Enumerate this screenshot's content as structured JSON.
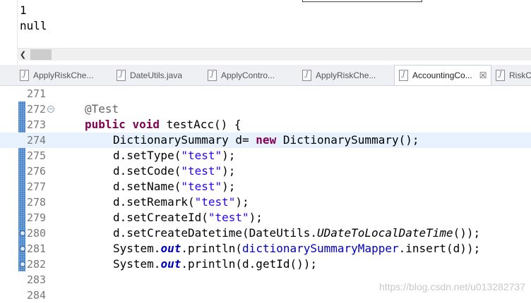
{
  "console": {
    "lines": [
      "1",
      "null"
    ]
  },
  "tabs": [
    {
      "label": "ApplyRiskChe...",
      "active": false
    },
    {
      "label": "DateUtils.java",
      "active": false
    },
    {
      "label": "ApplyContro...",
      "active": false
    },
    {
      "label": "ApplyRiskChe...",
      "active": false
    },
    {
      "label": "AccountingCo...",
      "active": true,
      "close": "☒"
    },
    {
      "label": "RiskCo",
      "active": false
    }
  ],
  "editor": {
    "current_line": 274,
    "lines": [
      {
        "number": "271",
        "tokens": []
      },
      {
        "number": "272",
        "tokens": [
          {
            "t": "@Test",
            "c": "ann"
          }
        ]
      },
      {
        "number": "273",
        "tokens": [
          {
            "t": "public",
            "c": "kw"
          },
          {
            "t": " "
          },
          {
            "t": "void",
            "c": "kw"
          },
          {
            "t": " testAcc() {"
          }
        ]
      },
      {
        "number": "274",
        "tokens": [
          {
            "t": "DictionarySummary d= "
          },
          {
            "t": "new",
            "c": "kw"
          },
          {
            "t": " DictionarySummary();"
          }
        ]
      },
      {
        "number": "275",
        "tokens": [
          {
            "t": "d.setType("
          },
          {
            "t": "\"test\"",
            "c": "str"
          },
          {
            "t": ");"
          }
        ]
      },
      {
        "number": "276",
        "tokens": [
          {
            "t": "d.setCode("
          },
          {
            "t": "\"test\"",
            "c": "str"
          },
          {
            "t": ");"
          }
        ]
      },
      {
        "number": "277",
        "tokens": [
          {
            "t": "d.setName("
          },
          {
            "t": "\"test\"",
            "c": "str"
          },
          {
            "t": ");"
          }
        ]
      },
      {
        "number": "278",
        "tokens": [
          {
            "t": "d.setRemark("
          },
          {
            "t": "\"test\"",
            "c": "str"
          },
          {
            "t": ");"
          }
        ]
      },
      {
        "number": "279",
        "tokens": [
          {
            "t": "d.setCreateId("
          },
          {
            "t": "\"test\"",
            "c": "str"
          },
          {
            "t": ");"
          }
        ]
      },
      {
        "number": "280",
        "tokens": [
          {
            "t": "d.setCreateDatetime(DateUtils."
          },
          {
            "t": "UDateToLocalDateTime",
            "c": "smethod"
          },
          {
            "t": "());"
          }
        ]
      },
      {
        "number": "281",
        "tokens": [
          {
            "t": "System."
          },
          {
            "t": "out",
            "c": "sfield"
          },
          {
            "t": ".println("
          },
          {
            "t": "dictionarySummaryMapper",
            "c": "field"
          },
          {
            "t": ".insert(d));"
          }
        ]
      },
      {
        "number": "282",
        "tokens": [
          {
            "t": "System."
          },
          {
            "t": "out",
            "c": "sfield"
          },
          {
            "t": ".println(d.getId());"
          }
        ]
      },
      {
        "number": "283",
        "tokens": []
      },
      {
        "number": "284",
        "tokens": []
      }
    ]
  },
  "watermark": "https://blog.csdn.net/u013282737"
}
